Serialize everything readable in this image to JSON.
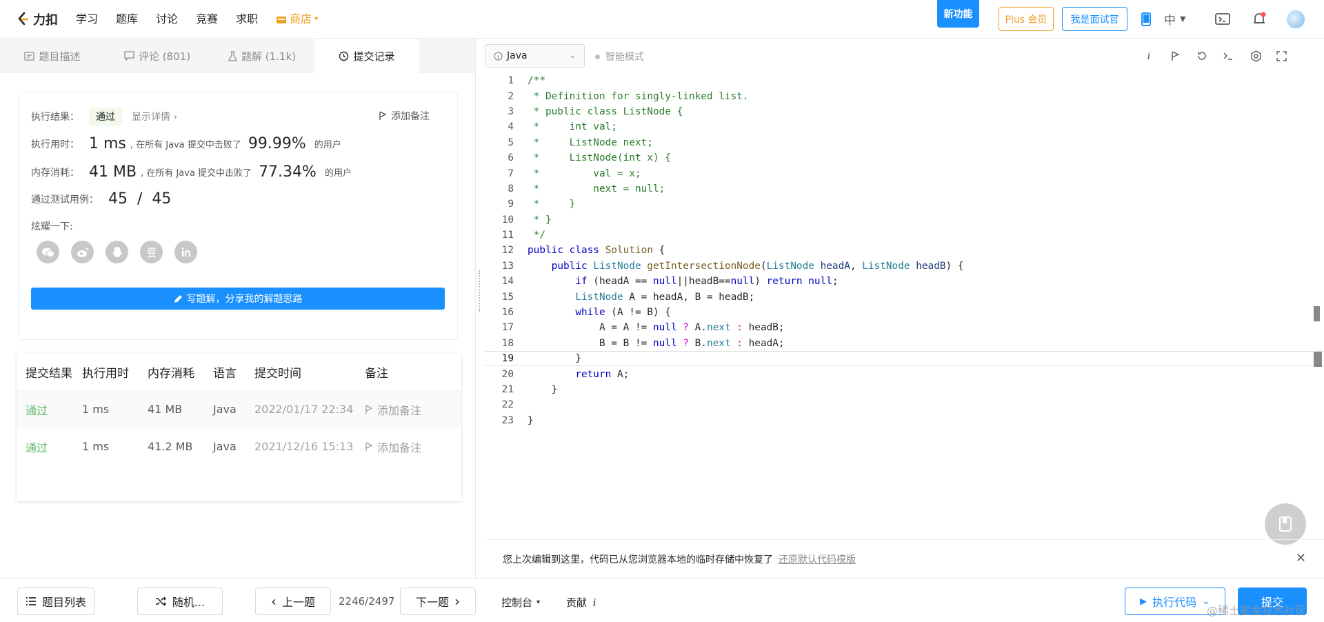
{
  "nav": {
    "logo": "力扣",
    "items": [
      "学习",
      "题库",
      "讨论",
      "竞赛",
      "求职"
    ],
    "store": "商店",
    "new_feature": "新功能",
    "plus": "Plus 会员",
    "interviewer": "我是面试官",
    "lang": "中"
  },
  "tabs": [
    {
      "label": "题目描述"
    },
    {
      "label": "评论 (801)"
    },
    {
      "label": "题解 (1.1k)"
    },
    {
      "label": "提交记录"
    }
  ],
  "result": {
    "label": "执行结果：",
    "status": "通过",
    "detail": "显示详情",
    "add_note": "添加备注",
    "time_label": "执行用时：",
    "time_value": "1 ms",
    "time_text": ", 在所有 Java 提交中击败了",
    "time_pct": "99.99%",
    "users": "的用户",
    "mem_label": "内存消耗：",
    "mem_value": "41 MB",
    "mem_text": ", 在所有 Java 提交中击败了",
    "mem_pct": "77.34%",
    "cases_label": "通过测试用例：",
    "cases_value": "45  /  45",
    "share_label": "炫耀一下:",
    "write_btn": "写题解，分享我的解题思路"
  },
  "submissions": {
    "headers": [
      "提交结果",
      "执行用时",
      "内存消耗",
      "语言",
      "提交时间",
      "备注"
    ],
    "rows": [
      {
        "status": "通过",
        "time": "1 ms",
        "mem": "41 MB",
        "lang": "Java",
        "date": "2022/01/17 22:34",
        "note": "添加备注"
      },
      {
        "status": "通过",
        "time": "1 ms",
        "mem": "41.2 MB",
        "lang": "Java",
        "date": "2021/12/16 15:13",
        "note": "添加备注"
      }
    ]
  },
  "editor": {
    "language": "Java",
    "smart_mode": "智能模式",
    "line_numbers": [
      "1",
      "2",
      "3",
      "4",
      "5",
      "6",
      "7",
      "8",
      "9",
      "10",
      "11",
      "12",
      "13",
      "14",
      "15",
      "16",
      "17",
      "18",
      "19",
      "20",
      "21",
      "22",
      "23"
    ]
  },
  "restore": {
    "message": "您上次编辑到这里，代码已从您浏览器本地的临时存储中恢复了",
    "link": "还原默认代码模版"
  },
  "bottom": {
    "problem_list": "题目列表",
    "random": "随机...",
    "prev": "上一题",
    "page": "2246/2497",
    "next": "下一题",
    "console": "控制台",
    "contribute": "贡献",
    "run": "执行代码",
    "submit": "提交"
  },
  "watermark": "@稀土掘金技术社区",
  "colors": {
    "accent": "#1a90ff",
    "pass": "#5cb85c",
    "plus": "#f0a020"
  }
}
